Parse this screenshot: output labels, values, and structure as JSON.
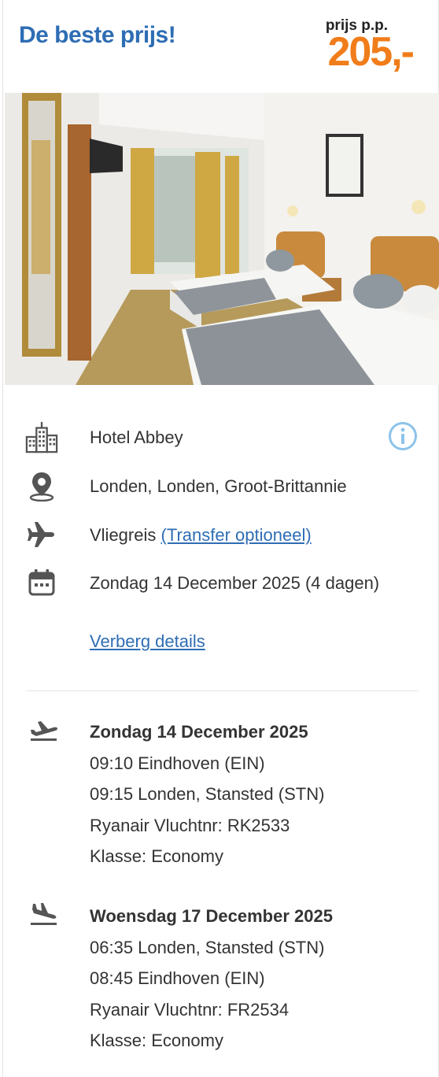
{
  "header": {
    "headline": "De beste prijs!",
    "price_label": "prijs p.p.",
    "price": "205,-"
  },
  "colors": {
    "brand_blue": "#2e6db4",
    "price_orange": "#f07d1a",
    "info_blue": "#8cc3ea",
    "icon_gray": "#555555"
  },
  "hotel": {
    "icon": "building-icon",
    "name": "Hotel Abbey",
    "info_icon": "info-circle-icon"
  },
  "location": {
    "icon": "map-pin-icon",
    "text": "Londen, Londen, Groot-Brittannie"
  },
  "travel": {
    "icon": "airplane-icon",
    "text": "Vliegreis",
    "link": "(Transfer optioneel)"
  },
  "dates": {
    "icon": "calendar-icon",
    "text": "Zondag 14 December 2025 (4 dagen)"
  },
  "details_toggle": "Verberg details",
  "flights": [
    {
      "icon": "departure-icon",
      "date": "Zondag 14 December 2025",
      "depart": "09:10 Eindhoven (EIN)",
      "arrive": "09:15 Londen, Stansted (STN)",
      "carrier": "Ryanair Vluchtnr: RK2533",
      "class": "Klasse: Economy"
    },
    {
      "icon": "arrival-icon",
      "date": "Woensdag 17 December 2025",
      "depart": "06:35 Londen, Stansted (STN)",
      "arrive": "08:45 Eindhoven (EIN)",
      "carrier": "Ryanair Vluchtnr: FR2534",
      "class": "Klasse: Economy"
    }
  ]
}
